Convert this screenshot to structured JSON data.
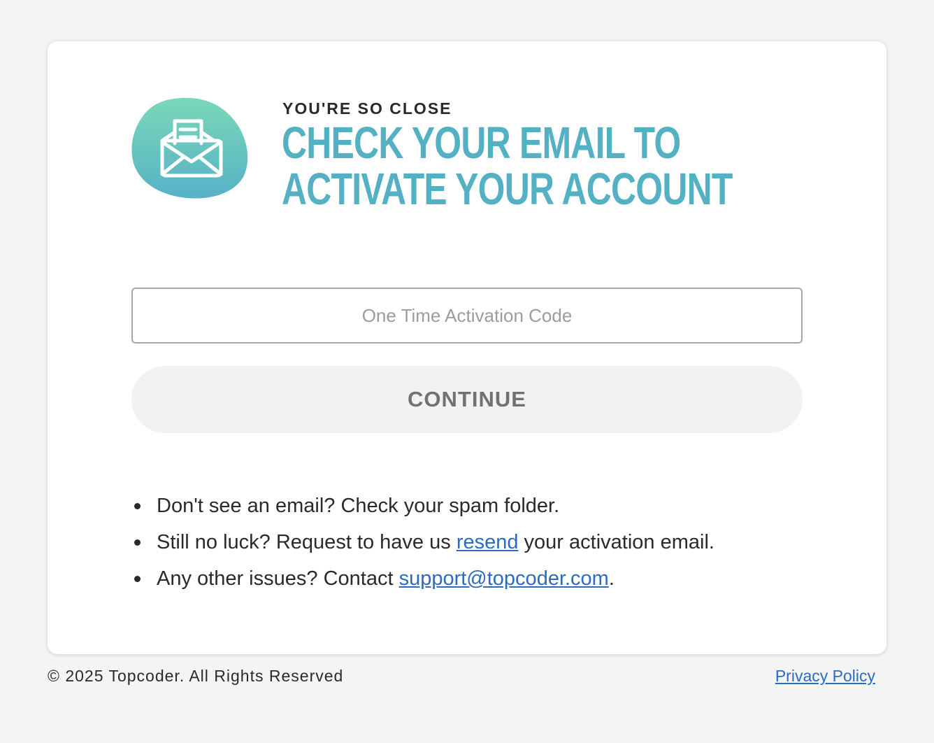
{
  "page": {
    "eyebrow": "YOU'RE SO CLOSE",
    "headline_line1": "CHECK YOUR EMAIL TO",
    "headline_line2": "ACTIVATE YOUR ACCOUNT",
    "hero_icon": "envelope-open-icon"
  },
  "form": {
    "code_placeholder": "One Time Activation Code",
    "code_value": "",
    "continue_label": "CONTINUE"
  },
  "help": {
    "item1": "Don't see an email? Check your spam folder.",
    "item2_prefix": "Still no luck? Request to have us ",
    "item2_link": "resend",
    "item2_suffix": " your activation email.",
    "item3_prefix": "Any other issues? Contact ",
    "item3_link": "support@topcoder.com",
    "item3_suffix": "."
  },
  "footer": {
    "copyright": "© 2025 Topcoder. All Rights Reserved",
    "privacy_label": "Privacy Policy"
  },
  "colors": {
    "accent": "#54b1c4",
    "link": "#2a6bc4",
    "icon_gradient_top": "#7ad8b8",
    "icon_gradient_bottom": "#56b1c6"
  }
}
